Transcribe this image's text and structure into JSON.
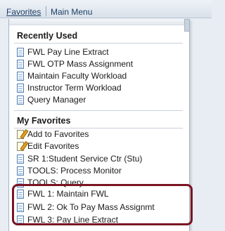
{
  "menubar": {
    "favorites": "Favorites",
    "main_menu": "Main Menu"
  },
  "recently_used": {
    "header": "Recently Used",
    "items": [
      "FWL Pay Line Extract",
      "FWL OTP Mass Assignment",
      "Maintain Faculty Workload",
      "Instructor Term Workload",
      "Query Manager"
    ]
  },
  "my_favorites": {
    "header": "My Favorites",
    "actions": [
      "Add to Favorites",
      "Edit Favorites"
    ],
    "items": [
      "SR 1:Student Service Ctr (Stu)",
      "TOOLS: Process Monitor",
      "TOOLS: Query",
      "FWL 1: Maintain FWL",
      "FWL 2: Ok To Pay Mass Assignmt",
      "FWL 3: Pay Line Extract"
    ]
  },
  "colors": {
    "highlight_border": "#7a1422",
    "link_text": "#1e3f66"
  }
}
